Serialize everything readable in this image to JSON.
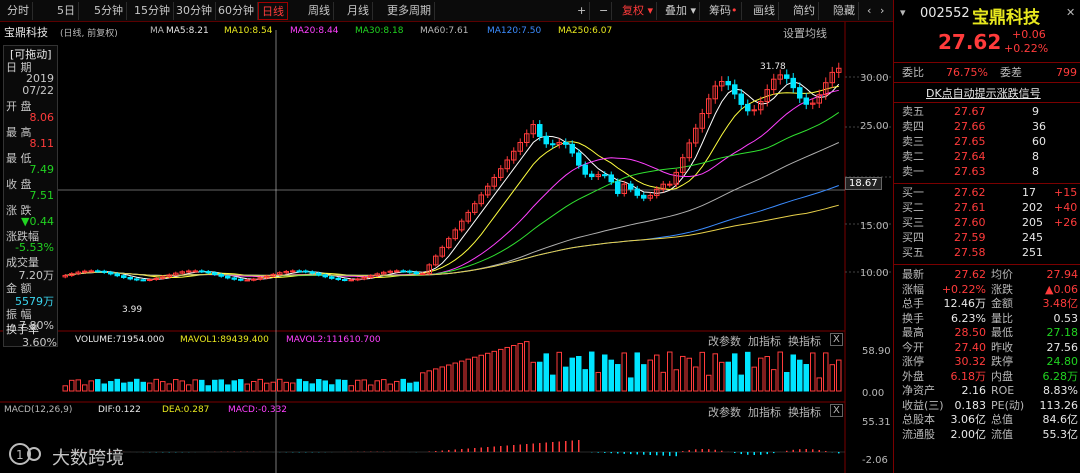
{
  "toolbar": {
    "items": [
      "分时",
      "5日",
      "5分钟",
      "15分钟",
      "30分钟",
      "60分钟",
      "日线",
      "周线",
      "月线",
      "更多周期"
    ],
    "active": "日线",
    "right_items": [
      "+",
      "−",
      "复权",
      "叠加",
      "筹码",
      "画线",
      "简约",
      "隐藏"
    ],
    "arrows": [
      "‹",
      "›"
    ]
  },
  "header": {
    "stock_name": "宝鼎科技",
    "adjust": "(日线, 前复权)",
    "ma_label": "MA",
    "ma5": "MA5:8.21",
    "ma10": "MA10:8.54",
    "ma20": "MA20:8.44",
    "ma30": "MA30:8.18",
    "ma60": "MA60:7.61",
    "ma120": "MA120:7.50",
    "ma250": "MA250:6.07",
    "settings": "设置均线"
  },
  "infobox": {
    "title": "[可拖动]",
    "date_label": "日 期",
    "year": "2019",
    "date": "07/22",
    "open_label": "开 盘",
    "open": "8.06",
    "high_label": "最 高",
    "high": "8.11",
    "low_label": "最 低",
    "low": "7.49",
    "close_label": "收 盘",
    "close": "7.51",
    "change_label": "涨 跌",
    "change": "▼0.44",
    "pct_label": "涨跌幅",
    "pct": "-5.53%",
    "volume_label": "成交量",
    "volume": "7.20万",
    "amount_label": "金 额",
    "amount": "5579万",
    "amplitude_label": "振 幅",
    "amplitude": "7.80%",
    "turnover_label": "换手率",
    "turnover": "3.60%"
  },
  "price_axis": [
    "30.00",
    "25.00",
    "18.67",
    "15.00",
    "10.00"
  ],
  "annotations": {
    "peak": "31.78",
    "low": "3.99"
  },
  "volume_pane": {
    "volume": "VOLUME:71954.000",
    "mavol1": "MAVOL1:89439.400",
    "mavol2": "MAVOL2:111610.700",
    "buttons": [
      "改参数",
      "加指标",
      "换指标"
    ],
    "close_sym": "X",
    "axis": [
      "58.90",
      "0.00"
    ]
  },
  "macd_pane": {
    "macd": "MACD(12,26,9)",
    "dif": "DIF:0.122",
    "dea": "DEA:0.287",
    "macd_val": "MACD:-0.332",
    "buttons": [
      "改参数",
      "加指标",
      "换指标"
    ],
    "close_sym": "X",
    "axis": [
      "55.31",
      "-2.06"
    ]
  },
  "watermark": "大数跨境",
  "quote": {
    "code": "002552",
    "name": "宝鼎科技",
    "price": "27.62",
    "change": "+0.06",
    "pct": "+0.22%",
    "weibi_label": "委比",
    "weibi": "76.75%",
    "weicha_label": "委差",
    "weicha": "799",
    "alert": "DK点自动提示涨跌信号",
    "sell": [
      {
        "label": "卖五",
        "price": "27.67",
        "vol": "9"
      },
      {
        "label": "卖四",
        "price": "27.66",
        "vol": "36"
      },
      {
        "label": "卖三",
        "price": "27.65",
        "vol": "60"
      },
      {
        "label": "卖二",
        "price": "27.64",
        "vol": "8"
      },
      {
        "label": "卖一",
        "price": "27.63",
        "vol": "8"
      }
    ],
    "buy": [
      {
        "label": "买一",
        "price": "27.62",
        "vol": "17",
        "chg": "+15"
      },
      {
        "label": "买二",
        "price": "27.61",
        "vol": "202",
        "chg": "+40"
      },
      {
        "label": "买三",
        "price": "27.60",
        "vol": "205",
        "chg": "+26"
      },
      {
        "label": "买四",
        "price": "27.59",
        "vol": "245",
        "chg": ""
      },
      {
        "label": "买五",
        "price": "27.58",
        "vol": "251",
        "chg": ""
      }
    ],
    "stats": [
      [
        "最新",
        "27.62",
        "均价",
        "27.94"
      ],
      [
        "涨幅",
        "+0.22%",
        "涨跌",
        "▲0.06"
      ],
      [
        "总手",
        "12.46万",
        "金额",
        "3.48亿"
      ],
      [
        "换手",
        "6.23%",
        "量比",
        "0.53"
      ],
      [
        "最高",
        "28.50",
        "最低",
        "27.18"
      ],
      [
        "今开",
        "27.40",
        "昨收",
        "27.56"
      ],
      [
        "涨停",
        "30.32",
        "跌停",
        "24.80"
      ],
      [
        "外盘",
        "6.18万",
        "内盘",
        "6.28万"
      ],
      [
        "净资产",
        "2.16",
        "ROE",
        "8.83%"
      ],
      [
        "收益(三)",
        "0.183",
        "PE(动)",
        "113.26"
      ],
      [
        "总股本",
        "3.06亿",
        "总值",
        "84.6亿"
      ],
      [
        "流通股",
        "2.00亿",
        "流值",
        "55.3亿"
      ]
    ]
  },
  "colors": {
    "up": "#ff3b3b",
    "down": "#00e5ff",
    "ma5": "#ffffff",
    "ma10": "#ffff40",
    "ma20": "#ff40ff",
    "ma30": "#30e030",
    "ma60": "#b0b0b0",
    "ma120": "#3b8cff",
    "ma250": "#e8d04a"
  }
}
